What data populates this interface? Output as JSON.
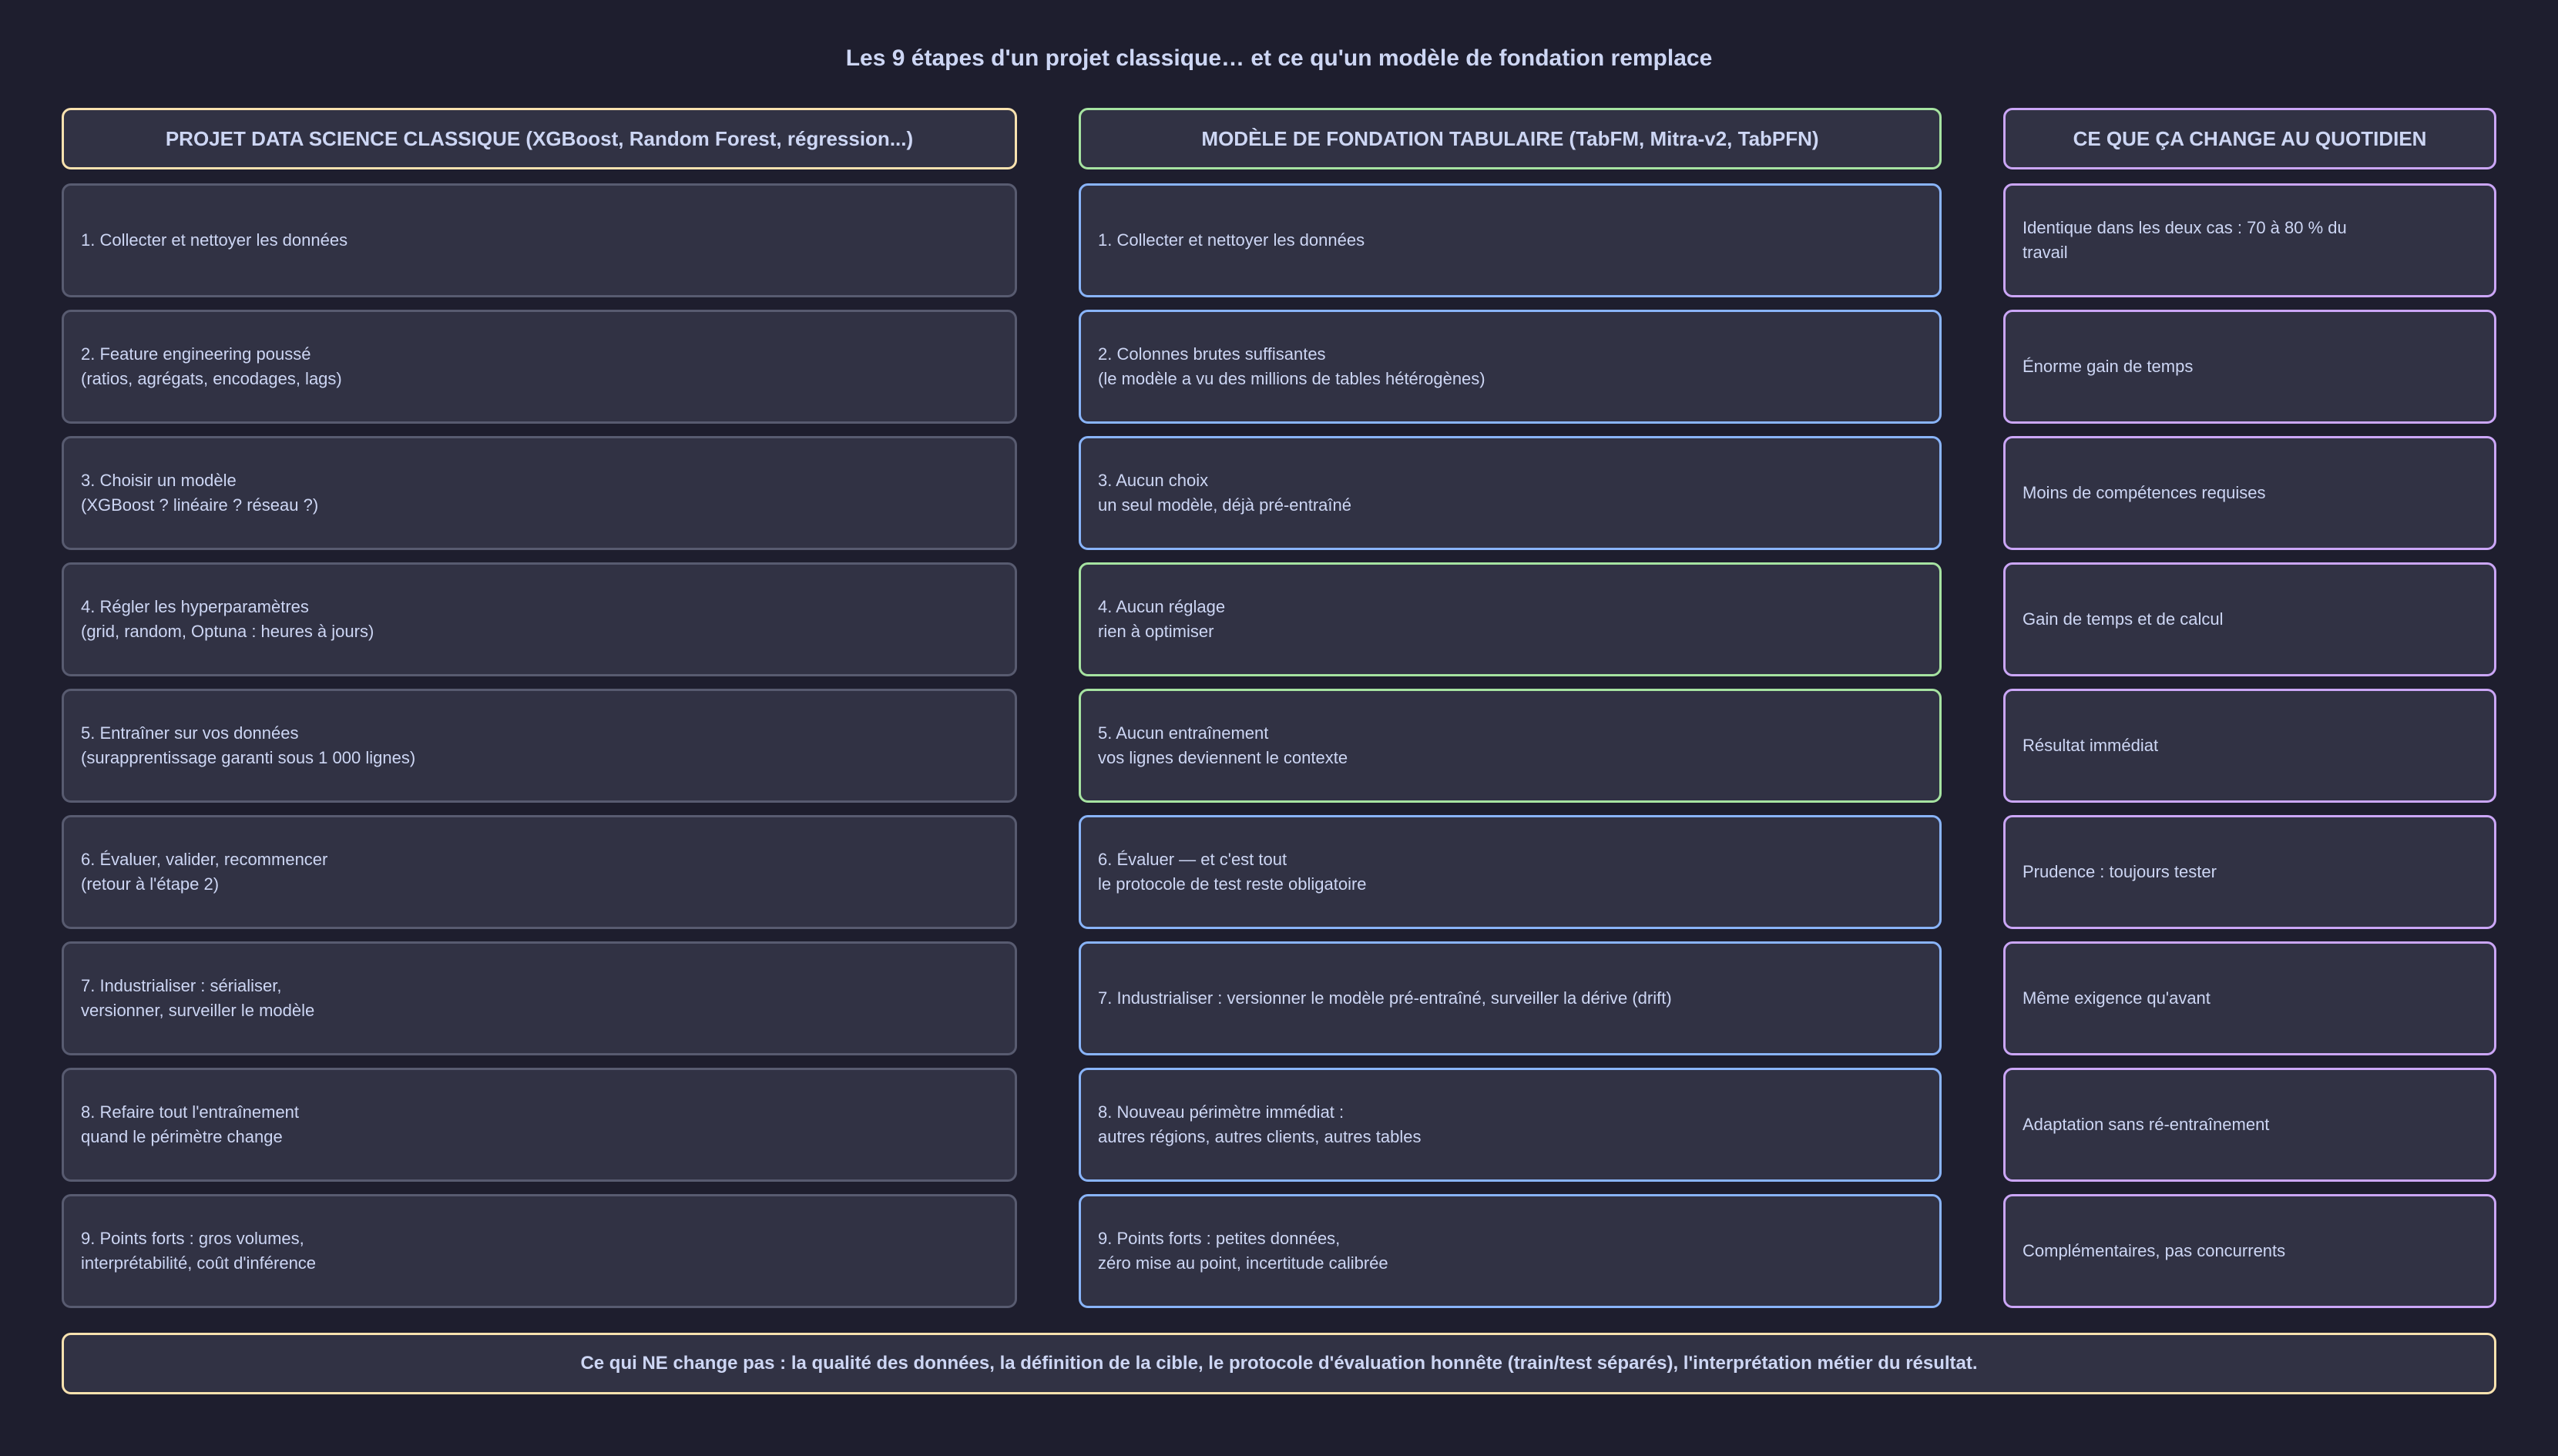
{
  "title": "Les 9 étapes d'un projet classique… et ce qu'un modèle de fondation remplace",
  "colors": {
    "background": "#1e1e2e",
    "box": "#313244",
    "text": "#cdd6f4",
    "yellow": "#f9e2af",
    "green": "#a6e3a1",
    "blue": "#89b4fa",
    "purple": "#cba6f7",
    "gray": "#585b70"
  },
  "columns": {
    "classic": {
      "header": "PROJET DATA SCIENCE CLASSIQUE (XGBoost, Random Forest, régression...)",
      "cells": [
        [
          "1. Collecter et nettoyer les données"
        ],
        [
          "2. Feature engineering poussé",
          "(ratios, agrégats, encodages, lags)"
        ],
        [
          "3. Choisir un modèle",
          "(XGBoost ? linéaire ? réseau ?)"
        ],
        [
          "4. Régler les hyperparamètres",
          "(grid, random, Optuna : heures à jours)"
        ],
        [
          "5. Entraîner sur vos données",
          "(surapprentissage garanti sous 1 000 lignes)"
        ],
        [
          "6. Évaluer, valider, recommencer",
          "(retour à l'étape 2)"
        ],
        [
          "7. Industrialiser : sérialiser,",
          "versionner, surveiller le modèle"
        ],
        [
          "8. Refaire tout l'entraînement",
          "quand le périmètre change"
        ],
        [
          "9. Points forts : gros volumes,",
          "interprétabilité, coût d'inférence"
        ]
      ]
    },
    "foundation": {
      "header": "MODÈLE DE FONDATION TABULAIRE (TabFM, Mitra-v2, TabPFN)",
      "cells": [
        [
          "1. Collecter et nettoyer les données"
        ],
        [
          "2. Colonnes brutes suffisantes",
          "(le modèle a vu des millions de tables hétérogènes)"
        ],
        [
          "3. Aucun choix",
          "un seul modèle, déjà pré-entraîné"
        ],
        [
          "4. Aucun réglage",
          "rien à optimiser"
        ],
        [
          "5. Aucun entraînement",
          "vos lignes deviennent le contexte"
        ],
        [
          "6. Évaluer — et c'est tout",
          "le protocole de test reste obligatoire"
        ],
        [
          "7. Industrialiser : versionner le modèle pré-entraîné, surveiller la dérive (drift)"
        ],
        [
          "8. Nouveau périmètre immédiat :",
          "autres régions, autres clients, autres tables"
        ],
        [
          "9. Points forts : petites données,",
          "zéro mise au point, incertitude calibrée"
        ]
      ],
      "green_rows": [
        3,
        4
      ]
    },
    "change": {
      "header": "CE QUE ÇA CHANGE AU QUOTIDIEN",
      "cells": [
        [
          "Identique dans les deux cas : 70 à 80 % du",
          "travail"
        ],
        [
          "Énorme gain de temps"
        ],
        [
          "Moins de compétences requises"
        ],
        [
          "Gain de temps et de calcul"
        ],
        [
          "Résultat immédiat"
        ],
        [
          "Prudence : toujours tester"
        ],
        [
          "Même exigence qu'avant"
        ],
        [
          "Adaptation sans ré-entraînement"
        ],
        [
          "Complémentaires, pas concurrents"
        ]
      ]
    }
  },
  "footer": "Ce qui NE change pas : la qualité des données, la définition de la cible, le protocole d'évaluation honnête (train/test séparés), l'interprétation métier du résultat."
}
